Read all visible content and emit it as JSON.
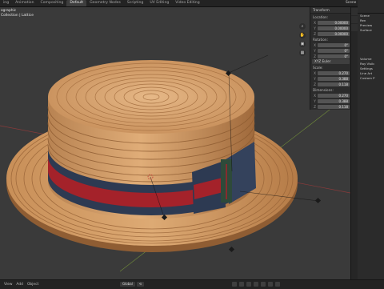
{
  "topbar": {
    "tabs": [
      {
        "label": "ing"
      },
      {
        "label": "Animation"
      },
      {
        "label": "Compositing"
      },
      {
        "label": "Default"
      },
      {
        "label": "Geometry Nodes"
      },
      {
        "label": "Scripting"
      },
      {
        "label": "UV Editing"
      },
      {
        "label": "Video Editing"
      }
    ],
    "active_tab": "Default",
    "scene_label": "Scene"
  },
  "viewport": {
    "overlay_line1": "ographic",
    "overlay_line2": "Collection | Lattice",
    "gizmo_buttons": [
      {
        "icon": "zoom-icon",
        "glyph": "⌕"
      },
      {
        "icon": "hand-icon",
        "glyph": "✋"
      },
      {
        "icon": "camera-icon",
        "glyph": "▣"
      },
      {
        "icon": "grid-icon",
        "glyph": "▦"
      }
    ]
  },
  "npanel": {
    "header": "Transform",
    "location_label": "Location:",
    "location": [
      {
        "axis": "X",
        "value": "0.00000"
      },
      {
        "axis": "Y",
        "value": "0.00000"
      },
      {
        "axis": "Z",
        "value": "0.00000"
      }
    ],
    "rotation_label": "Rotation:",
    "rotation": [
      {
        "axis": "X",
        "value": "0°"
      },
      {
        "axis": "Y",
        "value": "0°"
      },
      {
        "axis": "Z",
        "value": "0°"
      }
    ],
    "rotation_mode": "XYZ Euler",
    "scale_label": "Scale:",
    "scale": [
      {
        "axis": "X",
        "value": "0.270"
      },
      {
        "axis": "Y",
        "value": "0.388"
      },
      {
        "axis": "Z",
        "value": "0.118"
      }
    ],
    "dimensions_label": "Dimensions:",
    "dimensions": [
      {
        "axis": "X",
        "value": "0.270"
      },
      {
        "axis": "Y",
        "value": "0.388"
      },
      {
        "axis": "Z",
        "value": "0.118"
      }
    ]
  },
  "properties": {
    "rows": [
      "Scene",
      "Ren",
      "Preview",
      "Surface",
      "Volume",
      "Ray Visib",
      "Settings",
      "Line Art",
      "Custom P"
    ]
  },
  "statusbar": {
    "items": [
      "View",
      "Add",
      "Object"
    ],
    "tool_items": [
      "Global",
      "⟲"
    ]
  },
  "colors": {
    "viewport_bg": "#3a3a3a",
    "straw": "#d6a06a",
    "band_red": "#a4222a",
    "band_navy": "#2d3a52",
    "band_green": "#2e4a3a"
  }
}
